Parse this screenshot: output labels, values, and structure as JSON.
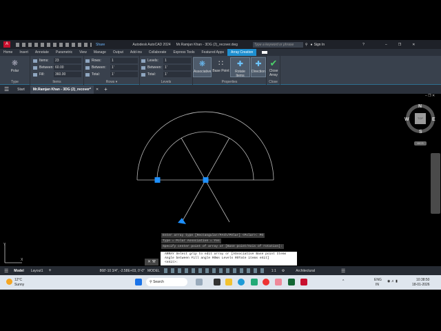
{
  "titlebar": {
    "app_icon": "A",
    "share": "Share",
    "title": "Autodesk AutoCAD 2024",
    "file": "Mr.Ramjan Khan - 3DG (2)_recover.dwg",
    "search_placeholder": "Type a keyword or phrase",
    "sign_in": "Sign In"
  },
  "tabs": [
    "Home",
    "Insert",
    "Annotate",
    "Parametric",
    "View",
    "Manage",
    "Output",
    "Add-ins",
    "Collaborate",
    "Express Tools",
    "Featured Apps",
    "Array Creation"
  ],
  "ribbon": {
    "type": {
      "button": "Polar",
      "title": "Type"
    },
    "items": {
      "items_label": "Items:",
      "items_value": "23",
      "between_label": "Between:",
      "between_value": "60.00",
      "fill_label": "Fill:",
      "fill_value": "360.00",
      "title": "Items"
    },
    "rows": {
      "rows_label": "Rows:",
      "rows_value": "1",
      "between_label": "Between:",
      "between_value": "1'",
      "total_label": "Total:",
      "total_value": "1'",
      "title": "Rows ▾"
    },
    "levels": {
      "levels_label": "Levels:",
      "levels_value": "1",
      "between_label": "Between:",
      "between_value": "1'",
      "total_label": "Total:",
      "total_value": "1'",
      "title": "Levels"
    },
    "properties": {
      "buttons": [
        "Associative",
        "Base Point",
        "Rotate Items",
        "Direction"
      ],
      "title": "Properties"
    },
    "close": {
      "button": "Close Array",
      "title": "Close"
    }
  },
  "file_tabs": {
    "start": "Start",
    "active": "Mr.Ramjan Khan - 3DG (2)_recover*"
  },
  "viewcube": {
    "n": "N",
    "s": "S",
    "e": "E",
    "w": "W",
    "top": "TOP",
    "wcs": "WCS"
  },
  "command": {
    "history": [
      "Enter array type [Rectangular/PAth/POlar] <Polar>: PO",
      "Type = Polar  Associative = Yes",
      "Specify center point of array or [Base point/Axis of rotation]:"
    ],
    "prompt": "ARRAY Select grip to edit array or [ASsociative Base point Items Angle between Fill angle ROWs Levels ROTate items eXit]",
    "prompt_tail": "<eXit>:"
  },
  "status": {
    "model_tab": "Model",
    "layout_tab": "Layout1",
    "coords": "868'-10 3/4\", -2.58E+03, 0'-0\"",
    "model": "MODEL",
    "scale": "1:1",
    "units": "Architectural"
  },
  "taskbar": {
    "temp": "12°C",
    "weather": "Sunny",
    "search": "Search",
    "lang": "ENG",
    "region": "IN",
    "time": "10:38:50",
    "date": "18-01-2026"
  },
  "colors": {
    "accent": "#1e8fd0",
    "grip": "#1e90ff"
  }
}
